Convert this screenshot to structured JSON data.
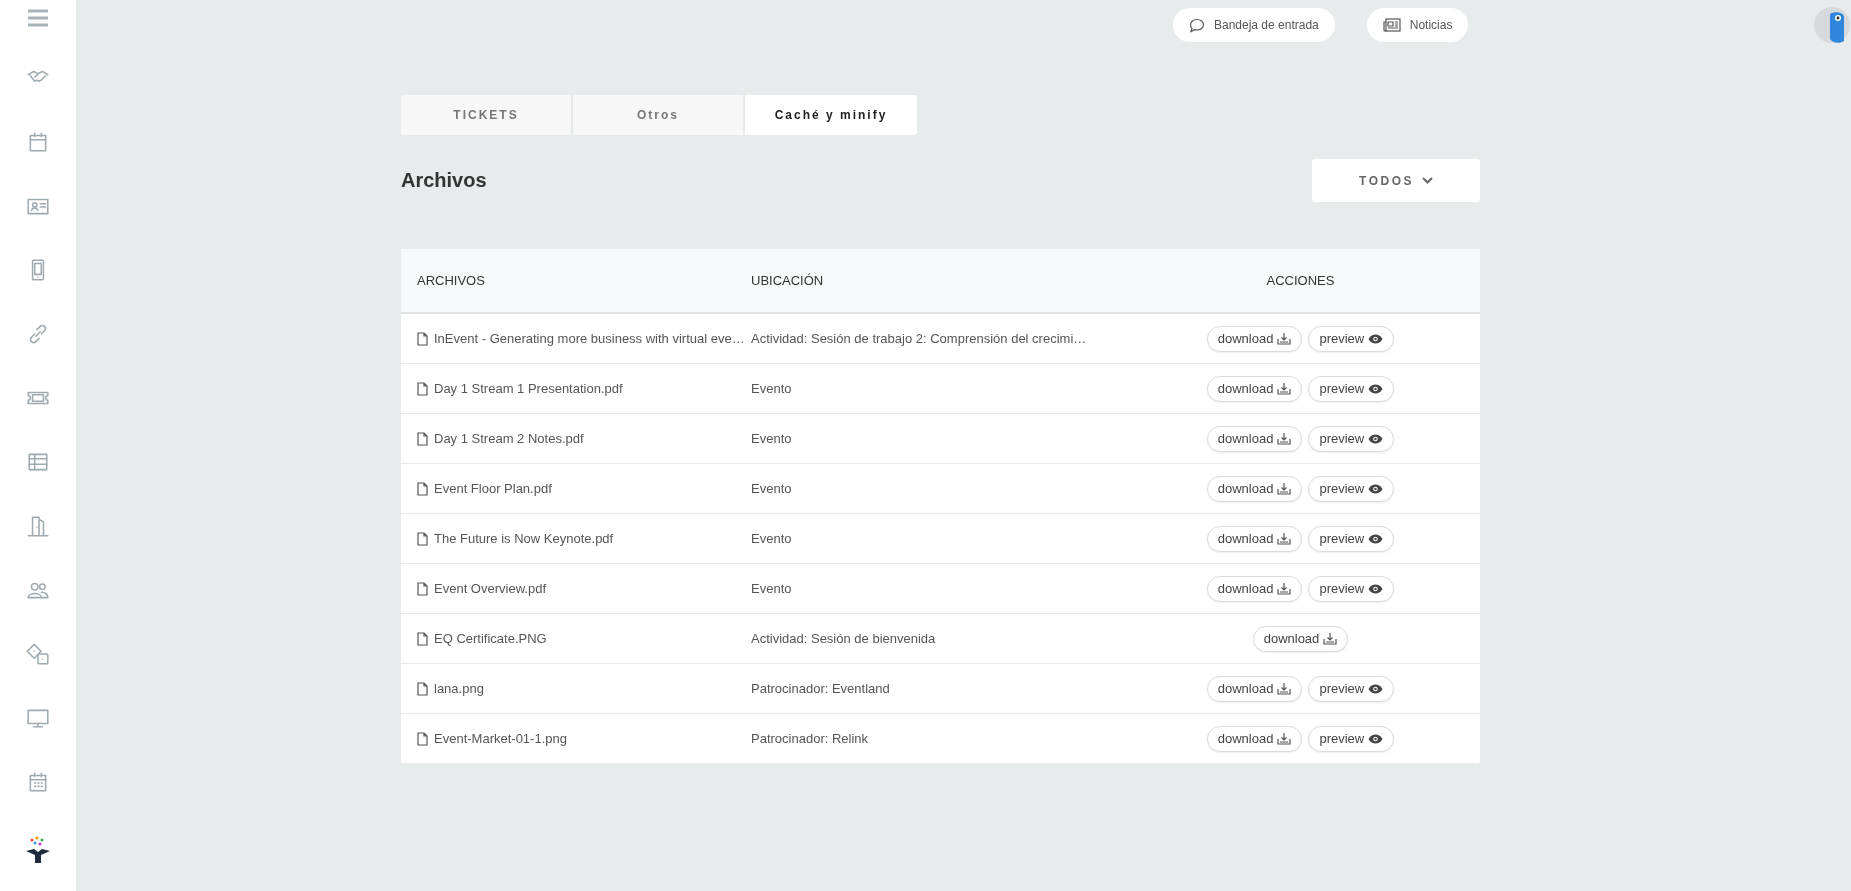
{
  "top_bar": {
    "buttons": [
      {
        "kind": "inbox",
        "label": "Bandeja de entrada"
      },
      {
        "kind": "news",
        "label": "Noticias"
      }
    ]
  },
  "tabs": [
    {
      "label": "TICKETS",
      "selected": false
    },
    {
      "label": "Otros",
      "selected": false
    },
    {
      "label": "Caché y minify",
      "selected": true
    }
  ],
  "section": {
    "title": "Archivos",
    "filter": "TODOS"
  },
  "table": {
    "columns": [
      "ARCHIVOS",
      "UBICACIÓN",
      "ACCIONES"
    ],
    "rows": [
      {
        "file": "InEvent - Generating more business with virtual eve…",
        "location": "Actividad: Sesión de trabajo 2: Comprensión del crecimi…",
        "actions": [
          {
            "kind": "download",
            "label": "download"
          },
          {
            "kind": "preview",
            "label": "preview"
          }
        ]
      },
      {
        "file": "Day 1 Stream 1 Presentation.pdf",
        "location": "Evento",
        "actions": [
          {
            "kind": "download",
            "label": "download"
          },
          {
            "kind": "preview",
            "label": "preview"
          }
        ]
      },
      {
        "file": "Day 1 Stream 2 Notes.pdf",
        "location": "Evento",
        "actions": [
          {
            "kind": "download",
            "label": "download"
          },
          {
            "kind": "preview",
            "label": "preview"
          }
        ]
      },
      {
        "file": "Event Floor Plan.pdf",
        "location": "Evento",
        "actions": [
          {
            "kind": "download",
            "label": "download"
          },
          {
            "kind": "preview",
            "label": "preview"
          }
        ]
      },
      {
        "file": "The Future is Now Keynote.pdf",
        "location": "Evento",
        "actions": [
          {
            "kind": "download",
            "label": "download"
          },
          {
            "kind": "preview",
            "label": "preview"
          }
        ]
      },
      {
        "file": "Event Overview.pdf",
        "location": "Evento",
        "actions": [
          {
            "kind": "download",
            "label": "download"
          },
          {
            "kind": "preview",
            "label": "preview"
          }
        ]
      },
      {
        "file": "EQ Certificate.PNG",
        "location": "Actividad: Sesión de bienvenida",
        "actions": [
          {
            "kind": "download",
            "label": "download"
          }
        ]
      },
      {
        "file": "lana.png",
        "location": "Patrocinador: Eventland",
        "actions": [
          {
            "kind": "download",
            "label": "download"
          },
          {
            "kind": "preview",
            "label": "preview"
          }
        ]
      },
      {
        "file": "Event-Market-01-1.png",
        "location": "Patrocinador: Relink",
        "actions": [
          {
            "kind": "download",
            "label": "download"
          },
          {
            "kind": "preview",
            "label": "preview"
          }
        ]
      }
    ]
  }
}
